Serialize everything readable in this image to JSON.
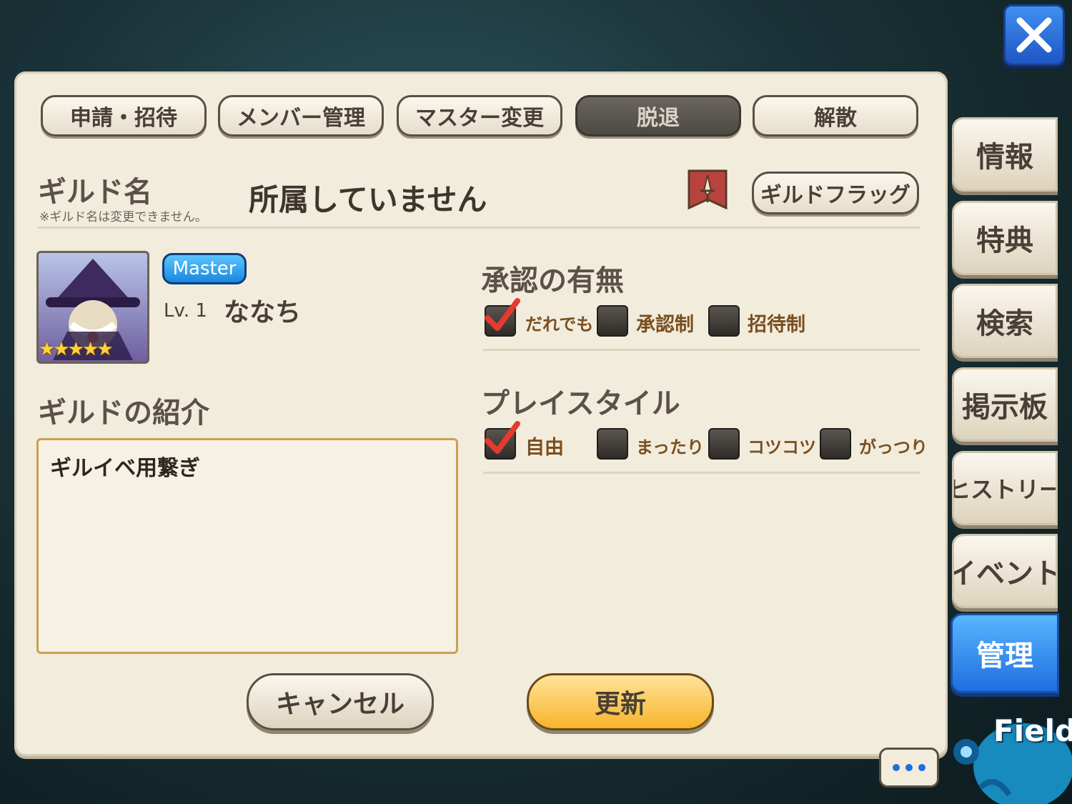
{
  "tabs": [
    {
      "label": "申請・招待"
    },
    {
      "label": "メンバー管理"
    },
    {
      "label": "マスター変更"
    },
    {
      "label": "脱退",
      "active": true
    },
    {
      "label": "解散"
    }
  ],
  "guild": {
    "name_label": "ギルド名",
    "name_note": "※ギルド名は変更できません。",
    "name_value": "所属していません",
    "flag_button": "ギルドフラッグ"
  },
  "member": {
    "role_badge": "Master",
    "level": "Lv. 1",
    "name": "ななち",
    "stars": "★★★★★"
  },
  "intro": {
    "label": "ギルドの紹介",
    "text": "ギルイベ用繋ぎ"
  },
  "approval": {
    "label": "承認の有無",
    "options": [
      {
        "label": "だれでも",
        "checked": true
      },
      {
        "label": "承認制",
        "checked": false
      },
      {
        "label": "招待制",
        "checked": false
      }
    ]
  },
  "playstyle": {
    "label": "プレイスタイル",
    "options": [
      {
        "label": "自由",
        "checked": true
      },
      {
        "label": "まったり",
        "checked": false
      },
      {
        "label": "コツコツ",
        "checked": false
      },
      {
        "label": "がっつり",
        "checked": false
      }
    ]
  },
  "buttons": {
    "cancel": "キャンセル",
    "update": "更新"
  },
  "sidebar": [
    {
      "label": "情報"
    },
    {
      "label": "特典"
    },
    {
      "label": "検索"
    },
    {
      "label": "掲示板"
    },
    {
      "label": "ヒストリー"
    },
    {
      "label": "イベント"
    },
    {
      "label": "管理",
      "active": true
    }
  ],
  "field_label": "Field",
  "colors": {
    "accent_blue": "#1f6ee0",
    "update_gold": "#f7b52a",
    "check_red": "#e53a30"
  }
}
